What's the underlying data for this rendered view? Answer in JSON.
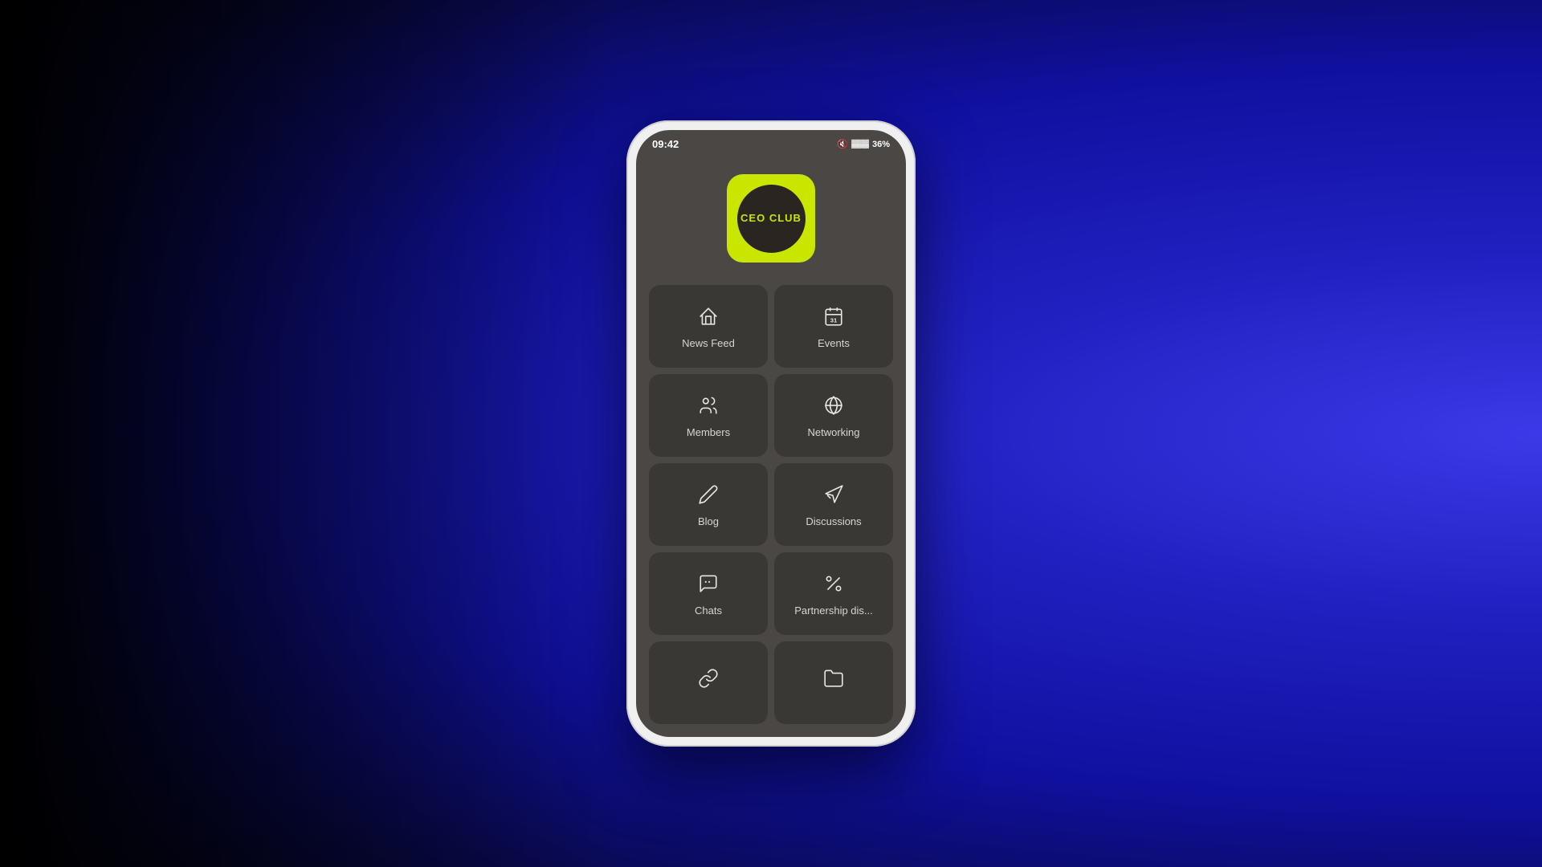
{
  "phone": {
    "status_bar": {
      "time": "09:42",
      "battery": "36%"
    },
    "logo": {
      "text": "CEO CLUB"
    },
    "menu_items": [
      {
        "id": "news-feed",
        "label": "News Feed",
        "icon": "home"
      },
      {
        "id": "events",
        "label": "Events",
        "icon": "calendar"
      },
      {
        "id": "members",
        "label": "Members",
        "icon": "people"
      },
      {
        "id": "networking",
        "label": "Networking",
        "icon": "globe"
      },
      {
        "id": "blog",
        "label": "Blog",
        "icon": "pencil"
      },
      {
        "id": "discussions",
        "label": "Discussions",
        "icon": "megaphone"
      },
      {
        "id": "chats",
        "label": "Chats",
        "icon": "chat"
      },
      {
        "id": "partnership",
        "label": "Partnership dis...",
        "icon": "percent"
      },
      {
        "id": "links",
        "label": "",
        "icon": "link"
      },
      {
        "id": "folder",
        "label": "",
        "icon": "folder"
      }
    ]
  }
}
